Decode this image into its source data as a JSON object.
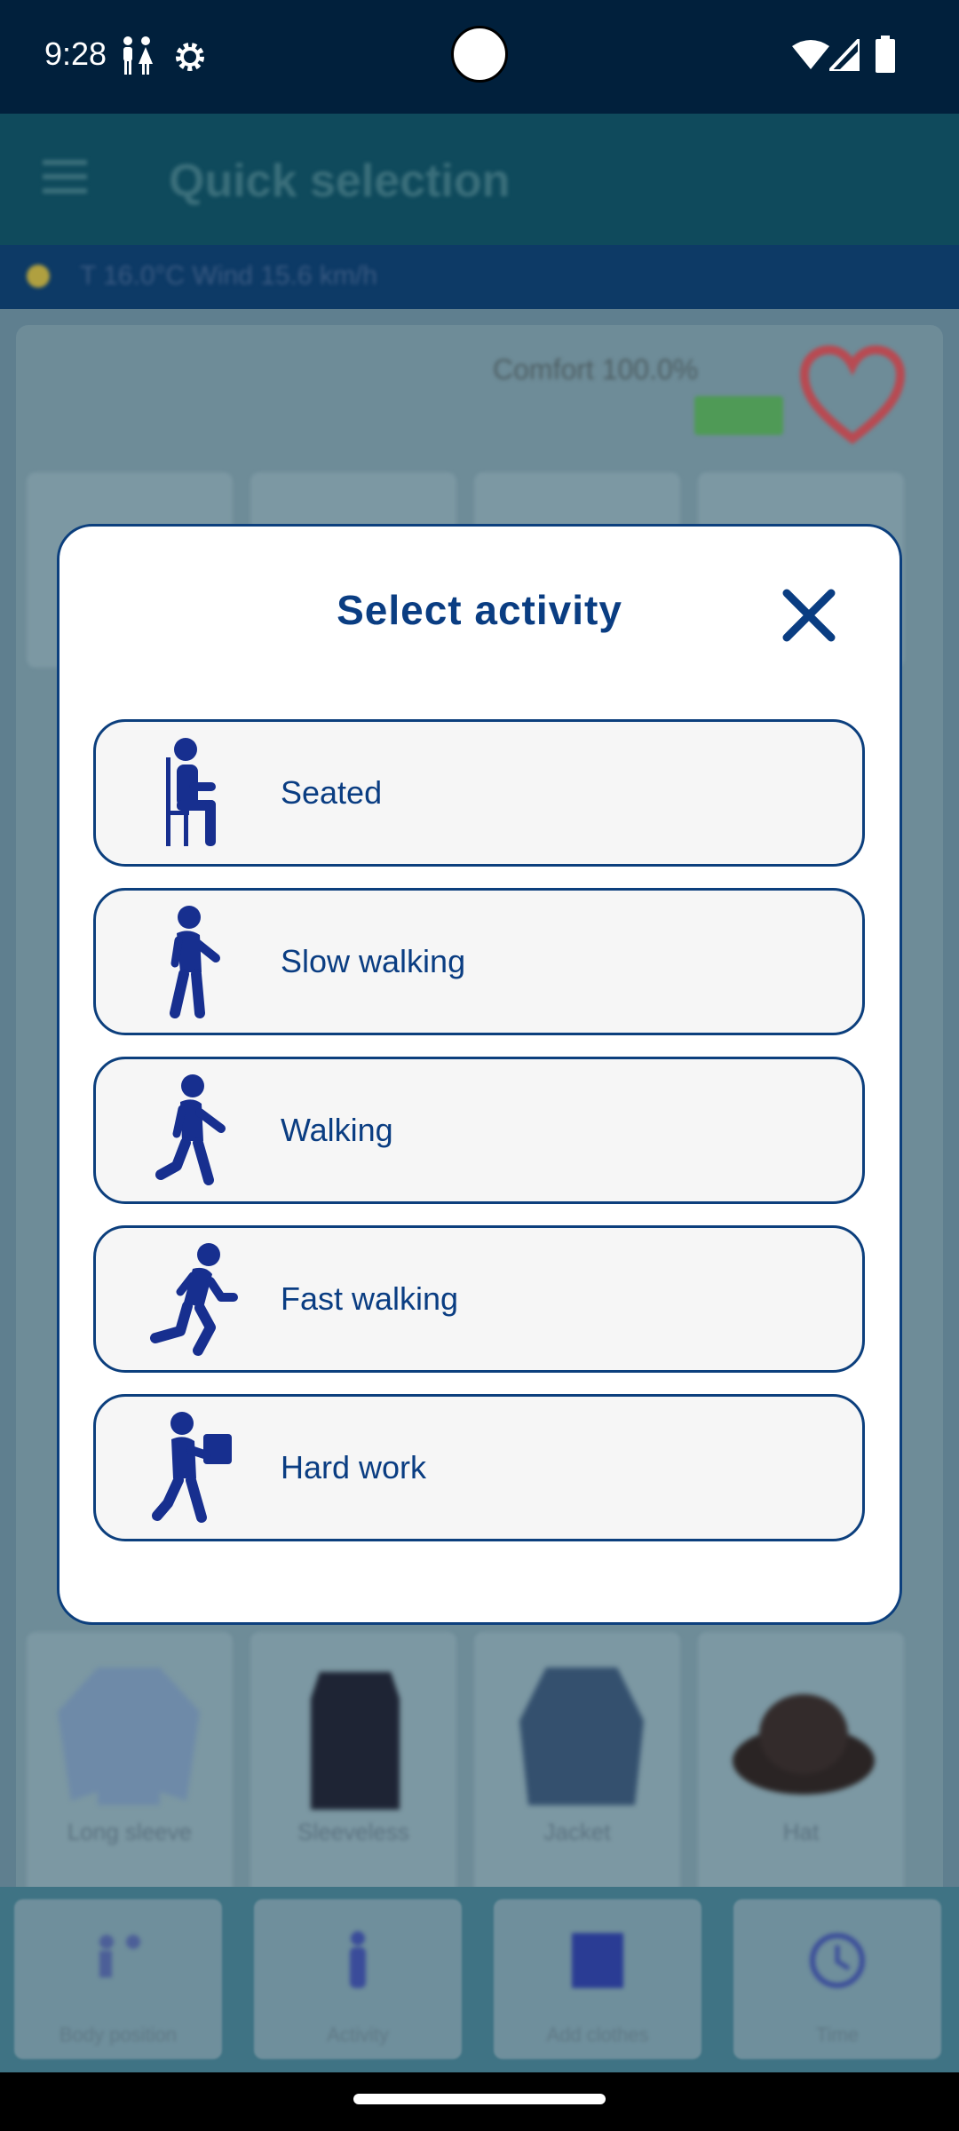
{
  "status_bar": {
    "time": "9:28",
    "icons": [
      "people-icon",
      "settings-gear-icon",
      "wifi-icon",
      "signal-icon",
      "battery-icon"
    ]
  },
  "background_app": {
    "title": "Quick selection",
    "menu_icon": "hamburger-menu-icon",
    "info_strip": "T 16.0°C Wind 15.6 km/h",
    "comfort_text": "Comfort 100.0%",
    "heart_icon": "heart-icon",
    "garment_labels": [
      "Long sleeve",
      "Sleeveless",
      "Jacket",
      "Hat"
    ],
    "bottom_nav": [
      "Body position",
      "Activity",
      "Add clothes",
      "Time"
    ]
  },
  "dialog": {
    "title": "Select activity",
    "close_icon": "close-x-icon",
    "options": [
      {
        "label": "Seated",
        "icon": "seated-person-icon"
      },
      {
        "label": "Slow walking",
        "icon": "slow-walking-person-icon"
      },
      {
        "label": "Walking",
        "icon": "walking-person-icon"
      },
      {
        "label": "Fast walking",
        "icon": "fast-walking-person-icon"
      },
      {
        "label": "Hard work",
        "icon": "carrying-box-person-icon"
      }
    ]
  },
  "colors": {
    "accent": "#0a3d82",
    "dialog_border": "#0c3f7d",
    "option_background": "#f6f6f6",
    "status_bar": "#01203c"
  }
}
